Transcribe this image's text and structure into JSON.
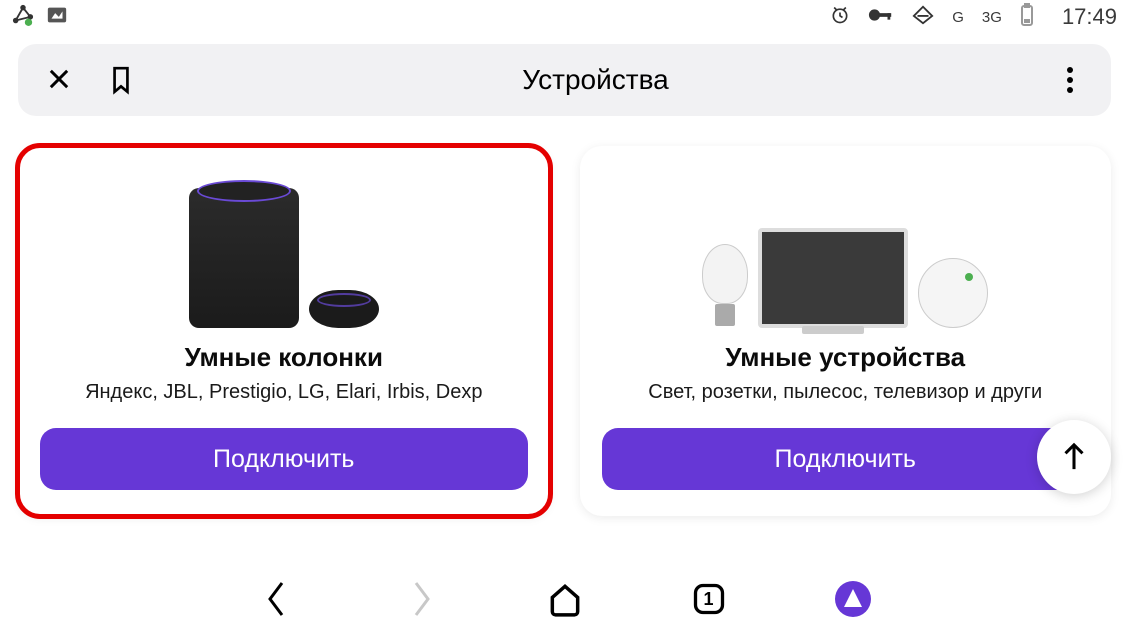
{
  "status": {
    "signal1": "G",
    "signal2": "3G",
    "time": "17:49"
  },
  "appbar": {
    "title": "Устройства"
  },
  "cards": [
    {
      "title": "Умные колонки",
      "subtitle": "Яндекс, JBL, Prestigio, LG, Elari, Irbis, Dexp",
      "button": "Подключить"
    },
    {
      "title": "Умные устройства",
      "subtitle": "Свет, розетки, пылесос, телевизор и други",
      "button": "Подключить"
    }
  ],
  "bottomnav": {
    "tab_count": "1"
  },
  "colors": {
    "accent": "#6637d6",
    "highlight": "#e40000"
  }
}
